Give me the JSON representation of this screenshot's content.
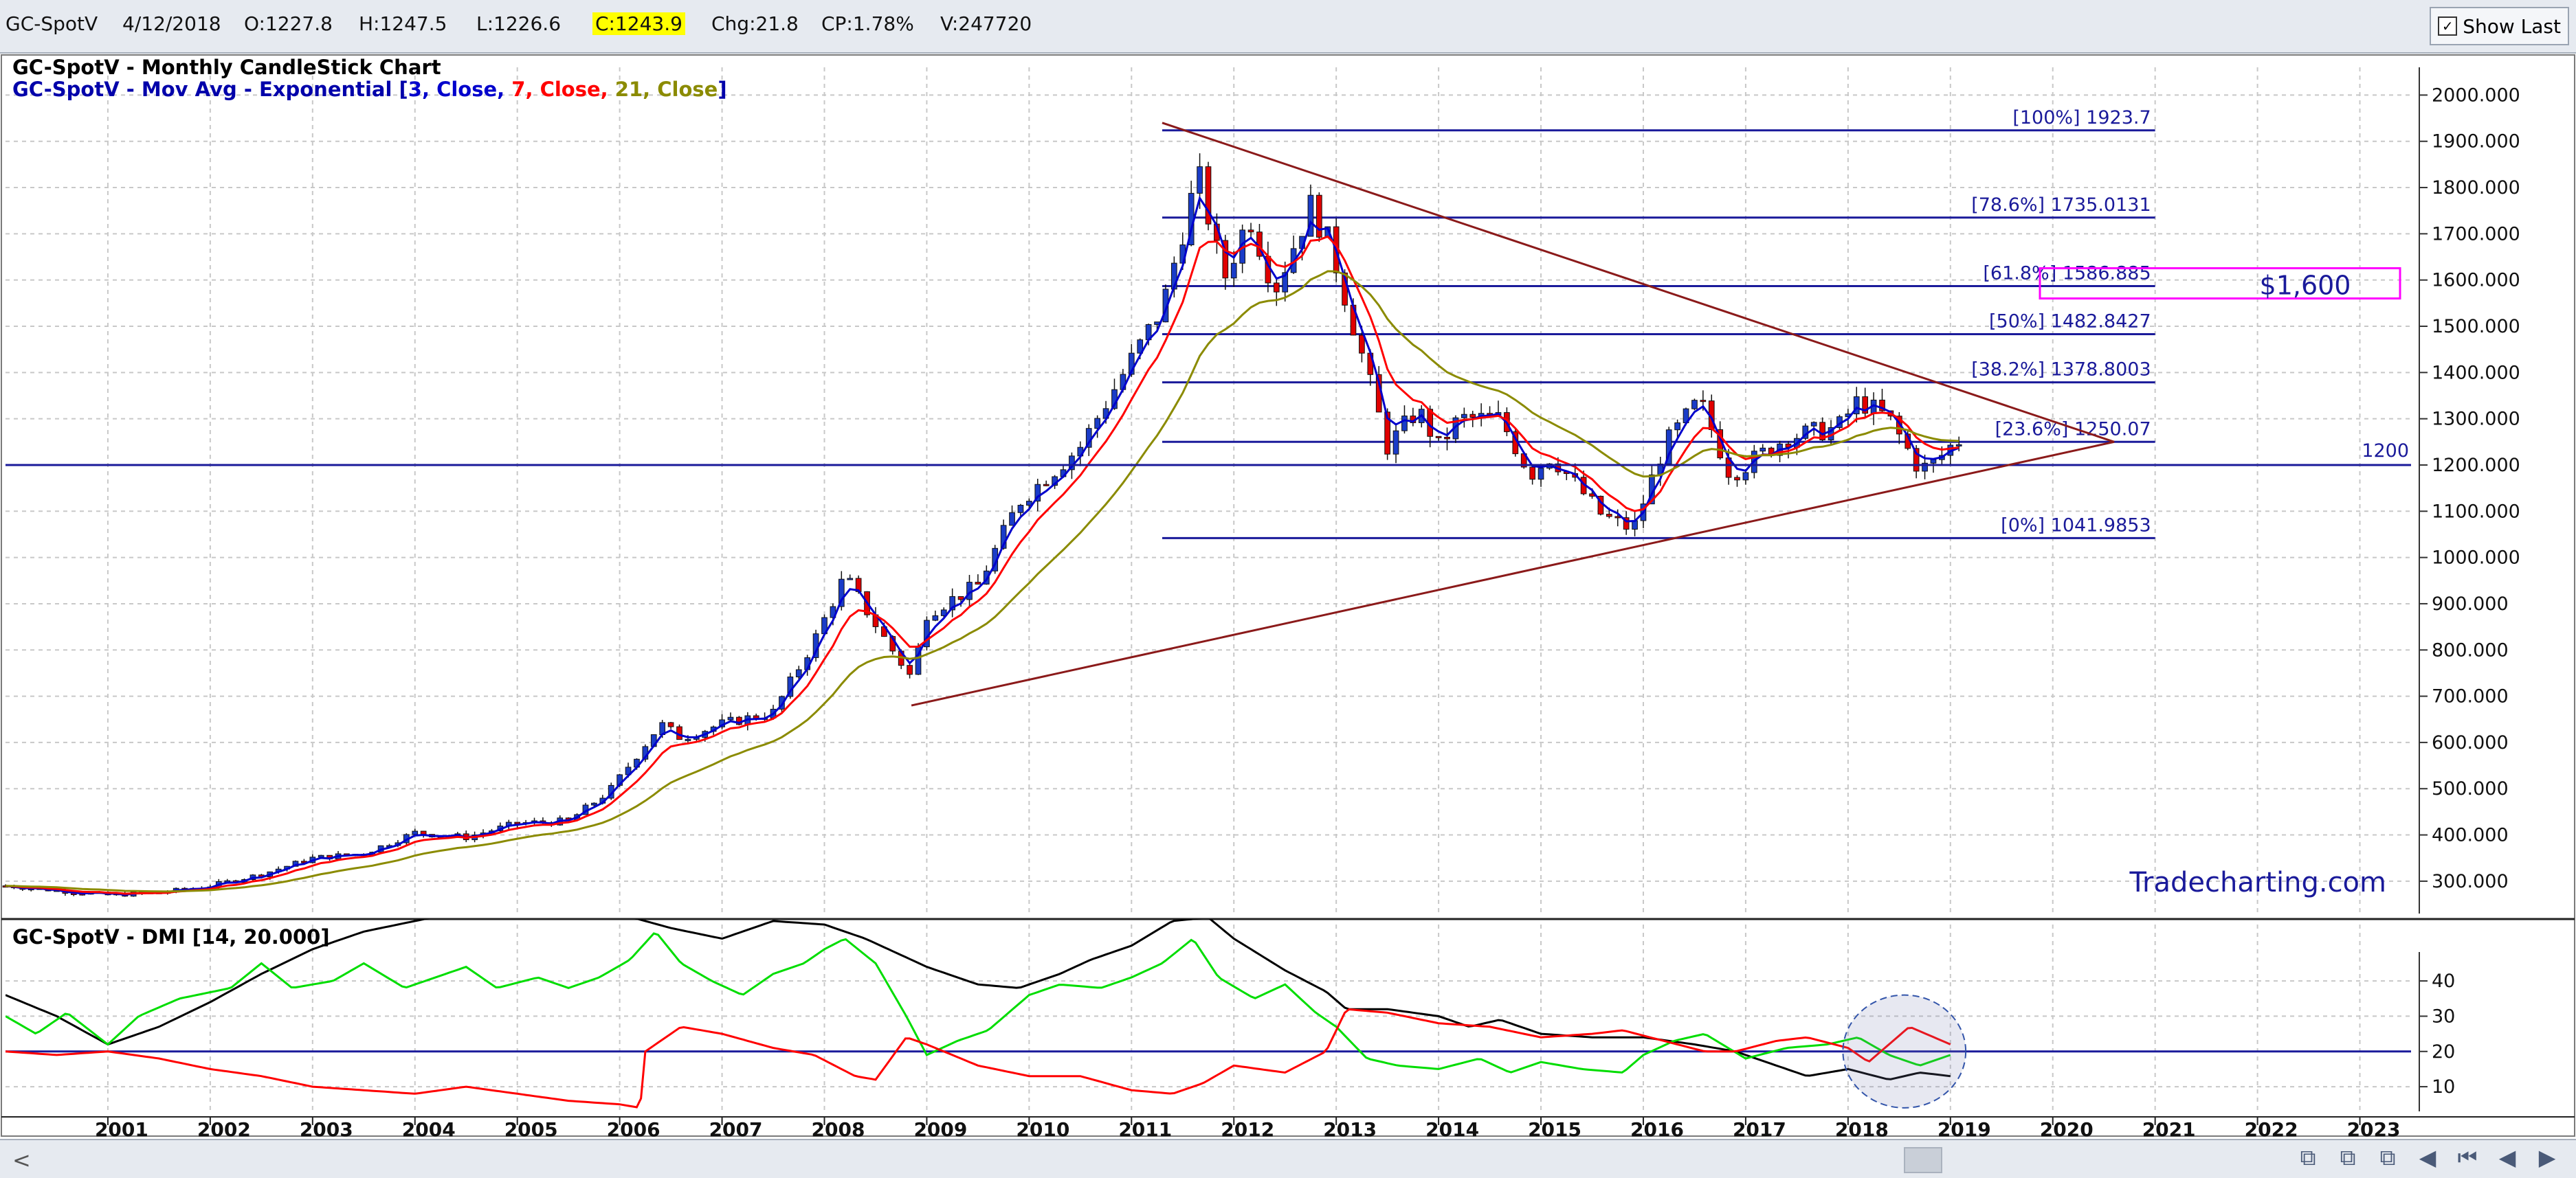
{
  "quote": {
    "symbol": "GC-SpotV",
    "date": "4/12/2018",
    "open": "O:1227.8",
    "high": "H:1247.5",
    "low": "L:1226.6",
    "close": "C:1243.9",
    "change": "Chg:21.8",
    "change_pct": "CP:1.78%",
    "volume": "V:247720",
    "show_last_label": "Show Last",
    "show_last_checked": "✓"
  },
  "colors": {
    "ema3": "#0000cc",
    "ema7": "#ff0000",
    "ema21": "#8b8b00",
    "di_plus": "#00dd00",
    "di_minus": "#ff0000",
    "adx": "#000000",
    "fib_line": "#1a1a9a",
    "triangle": "#8b1a1a",
    "highlight_box": "#ff00ff"
  },
  "chart_data": [
    {
      "type": "candlestick",
      "title_parts": [
        {
          "text": "GC-SpotV - Monthly CandleStick Chart",
          "color": "#000000"
        }
      ],
      "legend_parts": [
        {
          "text": "GC-SpotV - Mov Avg - Exponential [",
          "color": "#0000aa"
        },
        {
          "text": "3, Close, ",
          "color": "#0000cc"
        },
        {
          "text": "7, Close, ",
          "color": "#ff0000"
        },
        {
          "text": "21, Close",
          "color": "#8b8b00"
        },
        {
          "text": "]",
          "color": "#0000aa"
        }
      ],
      "x_ticks": [
        "2001",
        "2002",
        "2003",
        "2004",
        "2005",
        "2006",
        "2007",
        "2008",
        "2009",
        "2010",
        "2011",
        "2012",
        "2013",
        "2014",
        "2015",
        "2016",
        "2017",
        "2018",
        "2019",
        "2020",
        "2021",
        "2022",
        "2023"
      ],
      "xlim": [
        2000.0,
        2023.5
      ],
      "ylim": [
        230,
        2060
      ],
      "y_ticks": [
        300,
        400,
        500,
        600,
        700,
        800,
        900,
        1000,
        1100,
        1200,
        1300,
        1400,
        1500,
        1600,
        1700,
        1800,
        1900,
        2000
      ],
      "y_tick_labels": [
        "300.000",
        "400.000",
        "500.000",
        "600.000",
        "700.000",
        "800.000",
        "900.000",
        "1000.000",
        "1100.000",
        "1200.000",
        "1300.000",
        "1400.000",
        "1500.000",
        "1600.000",
        "1700.000",
        "1800.000",
        "1900.000",
        "2000.000"
      ],
      "price_anchors": [
        [
          2000.0,
          290
        ],
        [
          2001.0,
          270
        ],
        [
          2001.5,
          275
        ],
        [
          2002.0,
          290
        ],
        [
          2002.5,
          315
        ],
        [
          2003.0,
          350
        ],
        [
          2003.5,
          360
        ],
        [
          2004.0,
          405
        ],
        [
          2004.5,
          395
        ],
        [
          2005.0,
          425
        ],
        [
          2005.5,
          430
        ],
        [
          2005.9,
          495
        ],
        [
          2006.4,
          640
        ],
        [
          2006.6,
          610
        ],
        [
          2007.0,
          640
        ],
        [
          2007.5,
          665
        ],
        [
          2007.9,
          820
        ],
        [
          2008.2,
          960
        ],
        [
          2008.6,
          820
        ],
        [
          2008.85,
          740
        ],
        [
          2009.0,
          880
        ],
        [
          2009.5,
          940
        ],
        [
          2009.9,
          1120
        ],
        [
          2010.5,
          1240
        ],
        [
          2010.9,
          1390
        ],
        [
          2011.3,
          1540
        ],
        [
          2011.65,
          1830
        ],
        [
          2011.9,
          1600
        ],
        [
          2012.15,
          1740
        ],
        [
          2012.4,
          1580
        ],
        [
          2012.75,
          1760
        ],
        [
          2012.95,
          1670
        ],
        [
          2013.3,
          1400
        ],
        [
          2013.5,
          1240
        ],
        [
          2013.8,
          1320
        ],
        [
          2014.0,
          1240
        ],
        [
          2014.2,
          1300
        ],
        [
          2014.6,
          1300
        ],
        [
          2014.9,
          1180
        ],
        [
          2015.1,
          1220
        ],
        [
          2015.6,
          1090
        ],
        [
          2015.9,
          1060
        ],
        [
          2016.2,
          1240
        ],
        [
          2016.55,
          1340
        ],
        [
          2016.85,
          1180
        ],
        [
          2017.0,
          1200
        ],
        [
          2017.4,
          1260
        ],
        [
          2017.9,
          1280
        ],
        [
          2018.1,
          1340
        ],
        [
          2018.4,
          1300
        ],
        [
          2018.7,
          1190
        ],
        [
          2018.85,
          1205
        ],
        [
          2019.0,
          1240
        ],
        [
          2019.05,
          1243.9
        ]
      ],
      "fib_levels": [
        {
          "label": "[100%] 1923.7",
          "value": 1923.7
        },
        {
          "label": "[78.6%] 1735.0131",
          "value": 1735.0131
        },
        {
          "label": "[61.8%] 1586.885",
          "value": 1586.885
        },
        {
          "label": "[50%] 1482.8427",
          "value": 1482.8427
        },
        {
          "label": "[38.2%] 1378.8003",
          "value": 1378.8003
        },
        {
          "label": "[23.6%] 1250.07",
          "value": 1250.07
        },
        {
          "label": "[0%] 1041.9853",
          "value": 1041.9853
        }
      ],
      "fib_x_range": [
        2011.3,
        2021.0
      ],
      "horizontal_line": {
        "label": "1200",
        "value": 1200
      },
      "triangle": {
        "upper": {
          "from": [
            2011.3,
            1940
          ],
          "to": [
            2020.6,
            1250
          ]
        },
        "lower": {
          "from": [
            2008.85,
            680
          ],
          "to": [
            2020.6,
            1250
          ]
        }
      },
      "annotation": {
        "text": "$1,600",
        "value": 1586.885
      },
      "watermark": "Tradecharting.com"
    },
    {
      "type": "line",
      "title": "GC-SpotV - DMI [14, 20.000]",
      "ylim": [
        3,
        56
      ],
      "y_ticks": [
        10,
        20,
        30,
        40
      ],
      "y_tick_labels": [
        "10",
        "20",
        "30",
        "40"
      ],
      "threshold": 20,
      "series": [
        {
          "key": "adx",
          "points": [
            [
              2000.0,
              36
            ],
            [
              2000.5,
              30
            ],
            [
              2001.0,
              22
            ],
            [
              2001.5,
              27
            ],
            [
              2002.0,
              34
            ],
            [
              2002.5,
              42
            ],
            [
              2003.0,
              49
            ],
            [
              2003.5,
              54
            ],
            [
              2004.0,
              57
            ],
            [
              2004.5,
              60
            ],
            [
              2005.0,
              60
            ],
            [
              2005.5,
              60
            ],
            [
              2006.0,
              59
            ],
            [
              2006.5,
              55
            ],
            [
              2007.0,
              52
            ],
            [
              2007.5,
              57
            ],
            [
              2008.0,
              56
            ],
            [
              2008.4,
              52
            ],
            [
              2008.7,
              48
            ],
            [
              2009.0,
              44
            ],
            [
              2009.5,
              39
            ],
            [
              2009.9,
              38
            ],
            [
              2010.3,
              42
            ],
            [
              2010.6,
              46
            ],
            [
              2011.0,
              50
            ],
            [
              2011.4,
              57
            ],
            [
              2011.75,
              58
            ],
            [
              2012.0,
              52
            ],
            [
              2012.5,
              43
            ],
            [
              2012.9,
              37
            ],
            [
              2013.1,
              32
            ],
            [
              2013.5,
              32
            ],
            [
              2014.0,
              30
            ],
            [
              2014.3,
              27
            ],
            [
              2014.6,
              29
            ],
            [
              2015.0,
              25
            ],
            [
              2015.5,
              24
            ],
            [
              2016.0,
              24
            ],
            [
              2016.5,
              22
            ],
            [
              2016.9,
              20
            ],
            [
              2017.3,
              16
            ],
            [
              2017.6,
              13
            ],
            [
              2018.0,
              15
            ],
            [
              2018.4,
              12
            ],
            [
              2018.7,
              14
            ],
            [
              2019.0,
              13
            ]
          ]
        },
        {
          "key": "di_plus",
          "points": [
            [
              2000.0,
              30
            ],
            [
              2000.3,
              25
            ],
            [
              2000.6,
              31
            ],
            [
              2001.0,
              22
            ],
            [
              2001.3,
              30
            ],
            [
              2001.7,
              35
            ],
            [
              2002.2,
              38
            ],
            [
              2002.5,
              45
            ],
            [
              2002.8,
              38
            ],
            [
              2003.2,
              40
            ],
            [
              2003.5,
              45
            ],
            [
              2003.9,
              38
            ],
            [
              2004.2,
              41
            ],
            [
              2004.5,
              44
            ],
            [
              2004.8,
              38
            ],
            [
              2005.2,
              41
            ],
            [
              2005.5,
              38
            ],
            [
              2005.8,
              41
            ],
            [
              2006.1,
              46
            ],
            [
              2006.35,
              54
            ],
            [
              2006.6,
              45
            ],
            [
              2006.9,
              40
            ],
            [
              2007.2,
              36
            ],
            [
              2007.5,
              42
            ],
            [
              2007.8,
              45
            ],
            [
              2008.0,
              49
            ],
            [
              2008.2,
              52
            ],
            [
              2008.5,
              45
            ],
            [
              2008.8,
              30
            ],
            [
              2009.0,
              19
            ],
            [
              2009.3,
              23
            ],
            [
              2009.6,
              26
            ],
            [
              2010.0,
              36
            ],
            [
              2010.3,
              39
            ],
            [
              2010.7,
              38
            ],
            [
              2011.0,
              41
            ],
            [
              2011.3,
              45
            ],
            [
              2011.6,
              52
            ],
            [
              2011.85,
              41
            ],
            [
              2012.2,
              35
            ],
            [
              2012.5,
              39
            ],
            [
              2012.8,
              31
            ],
            [
              2013.0,
              27
            ],
            [
              2013.3,
              18
            ],
            [
              2013.6,
              16
            ],
            [
              2014.0,
              15
            ],
            [
              2014.4,
              18
            ],
            [
              2014.7,
              14
            ],
            [
              2015.0,
              17
            ],
            [
              2015.4,
              15
            ],
            [
              2015.8,
              14
            ],
            [
              2016.0,
              19
            ],
            [
              2016.3,
              23
            ],
            [
              2016.6,
              25
            ],
            [
              2017.0,
              18
            ],
            [
              2017.4,
              21
            ],
            [
              2017.8,
              22
            ],
            [
              2018.1,
              24
            ],
            [
              2018.4,
              19
            ],
            [
              2018.7,
              16
            ],
            [
              2019.0,
              19
            ]
          ]
        },
        {
          "key": "di_minus",
          "points": [
            [
              2000.0,
              20
            ],
            [
              2000.5,
              19
            ],
            [
              2001.0,
              20
            ],
            [
              2001.5,
              18
            ],
            [
              2002.0,
              15
            ],
            [
              2002.5,
              13
            ],
            [
              2003.0,
              10
            ],
            [
              2003.5,
              9
            ],
            [
              2004.0,
              8
            ],
            [
              2004.5,
              10
            ],
            [
              2005.0,
              8
            ],
            [
              2005.5,
              6
            ],
            [
              2006.0,
              5
            ],
            [
              2006.2,
              4
            ],
            [
              2006.25,
              20
            ],
            [
              2006.6,
              27
            ],
            [
              2007.0,
              25
            ],
            [
              2007.5,
              21
            ],
            [
              2007.9,
              19
            ],
            [
              2008.3,
              13
            ],
            [
              2008.5,
              12
            ],
            [
              2008.8,
              24
            ],
            [
              2009.0,
              22
            ],
            [
              2009.5,
              16
            ],
            [
              2010.0,
              13
            ],
            [
              2010.5,
              13
            ],
            [
              2011.0,
              9
            ],
            [
              2011.4,
              8
            ],
            [
              2011.7,
              11
            ],
            [
              2012.0,
              16
            ],
            [
              2012.5,
              14
            ],
            [
              2012.9,
              20
            ],
            [
              2013.1,
              32
            ],
            [
              2013.5,
              31
            ],
            [
              2014.0,
              28
            ],
            [
              2014.5,
              27
            ],
            [
              2015.0,
              24
            ],
            [
              2015.5,
              25
            ],
            [
              2015.8,
              26
            ],
            [
              2016.2,
              23
            ],
            [
              2016.6,
              20
            ],
            [
              2016.9,
              20
            ],
            [
              2017.3,
              23
            ],
            [
              2017.6,
              24
            ],
            [
              2018.0,
              21
            ],
            [
              2018.2,
              17
            ],
            [
              2018.4,
              22
            ],
            [
              2018.6,
              27
            ],
            [
              2019.0,
              22
            ]
          ]
        }
      ],
      "highlight": {
        "center": [
          2018.55,
          20
        ],
        "rx_years": 0.6,
        "ry": 16
      }
    }
  ],
  "status_bar": {
    "scroll_left": "<",
    "nav_buttons": [
      "⧉",
      "⧉",
      "⧉",
      "◀",
      "⏮",
      "◀",
      "▶"
    ]
  }
}
